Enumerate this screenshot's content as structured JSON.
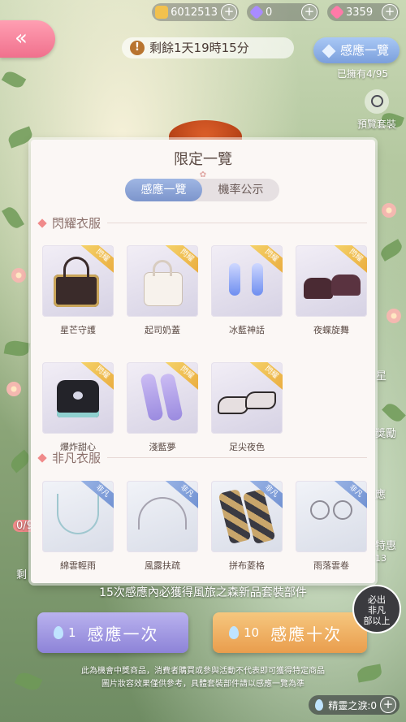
{
  "currencies": [
    {
      "name": "gold-coin-icon",
      "value": "6012513",
      "color": "#f2c14e"
    },
    {
      "name": "diamond-icon",
      "value": "0",
      "color": "#a98bff"
    },
    {
      "name": "pink-diamond-icon",
      "value": "3359",
      "color": "#ff7aa8"
    }
  ],
  "header": {
    "timer": "剩餘1天19時15分",
    "catalog_button": "感應一覽",
    "owned": "已擁有4/95",
    "preview_label": "預覽套裝"
  },
  "side": {
    "progress": "0/9",
    "left_char": "剩",
    "right_1": "星",
    "right_2": "獎勵",
    "right_3": "應",
    "right_4": "特惠",
    "right_5": "13"
  },
  "modal": {
    "title": "限定一覽",
    "tabs": [
      "感應一覽",
      "機率公示"
    ],
    "section_shining": "閃耀衣服",
    "section_extraordinary": "非凡衣服",
    "tag_shining": "閃耀",
    "tag_extraordinary": "非凡",
    "shining_items": [
      "星芒守護",
      "起司奶蓋",
      "冰藍神話",
      "夜蝶旋舞",
      "爆炸甜心",
      "淺藍夢",
      "足尖夜色"
    ],
    "extraordinary_items": [
      "綿雲輕雨",
      "風露扶疏",
      "拼布菱格",
      "雨落雲卷"
    ]
  },
  "footer": {
    "guarantee": "15次感應內必獲得風旅之森新品套裝部件",
    "draw_one_cost": "1",
    "draw_one_label": "感應一次",
    "draw_ten_cost": "10",
    "draw_ten_label": "感應十次",
    "badge": "必出\n非凡\n部以上",
    "disclaimer_1": "此為機會中獎商品，消費者購買或參與活動不代表即可獲得特定商品",
    "disclaimer_2": "圖片妝容效果僅供參考，具體套裝部件請以感應一覽為準",
    "tears": "精靈之淚:0"
  }
}
